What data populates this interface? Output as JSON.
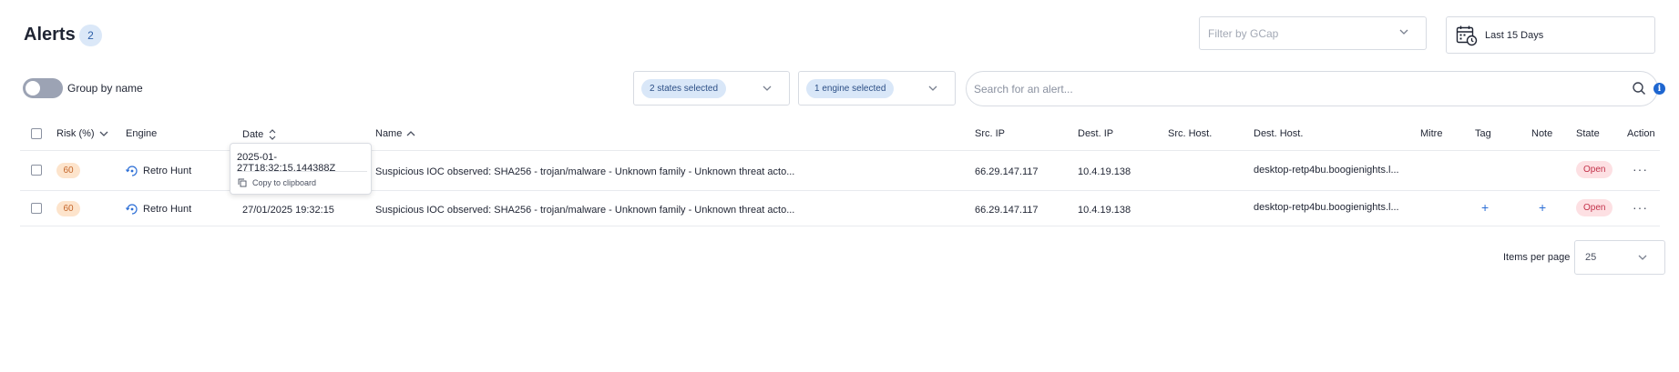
{
  "header": {
    "title": "Alerts",
    "count": "2",
    "gcap_placeholder": "Filter by GCap",
    "date_range": "Last 15 Days"
  },
  "toolbar": {
    "group_by_label": "Group by name",
    "states_chip": "2 states selected",
    "engine_chip": "1 engine selected",
    "search_placeholder": "Search for an alert..."
  },
  "table": {
    "columns": {
      "risk": "Risk (%)",
      "engine": "Engine",
      "date": "Date",
      "name": "Name",
      "src_ip": "Src. IP",
      "dest_ip": "Dest. IP",
      "src_host": "Src. Host.",
      "dest_host": "Dest. Host.",
      "mitre": "Mitre",
      "tag": "Tag",
      "note": "Note",
      "state": "State",
      "action": "Action"
    },
    "rows": [
      {
        "risk": "60",
        "engine": "Retro Hunt",
        "date": "",
        "name": "Suspicious IOC observed: SHA256 - trojan/malware - Unknown family - Unknown threat acto...",
        "src_ip": "66.29.147.117",
        "dest_ip": "10.4.19.138",
        "src_host": "",
        "dest_host": "desktop-retp4bu.boogienights.l...",
        "state": "Open"
      },
      {
        "risk": "60",
        "engine": "Retro Hunt",
        "date": "27/01/2025 19:32:15",
        "name": "Suspicious IOC observed: SHA256 - trojan/malware - Unknown family - Unknown threat acto...",
        "src_ip": "66.29.147.117",
        "dest_ip": "10.4.19.138",
        "src_host": "",
        "dest_host": "desktop-retp4bu.boogienights.l...",
        "state": "Open"
      }
    ]
  },
  "tooltip": {
    "timestamp": "2025-01-27T18:32:15.144388Z",
    "copy_label": "Copy to clipboard"
  },
  "pagination": {
    "items_per_page_label": "Items per page",
    "items_per_page_value": "25"
  },
  "colors": {
    "accent": "#1e66d0",
    "risk_bg": "#fde4cc",
    "risk_text": "#c4662b",
    "state_bg": "#fde0e3",
    "state_text": "#c3324a"
  }
}
